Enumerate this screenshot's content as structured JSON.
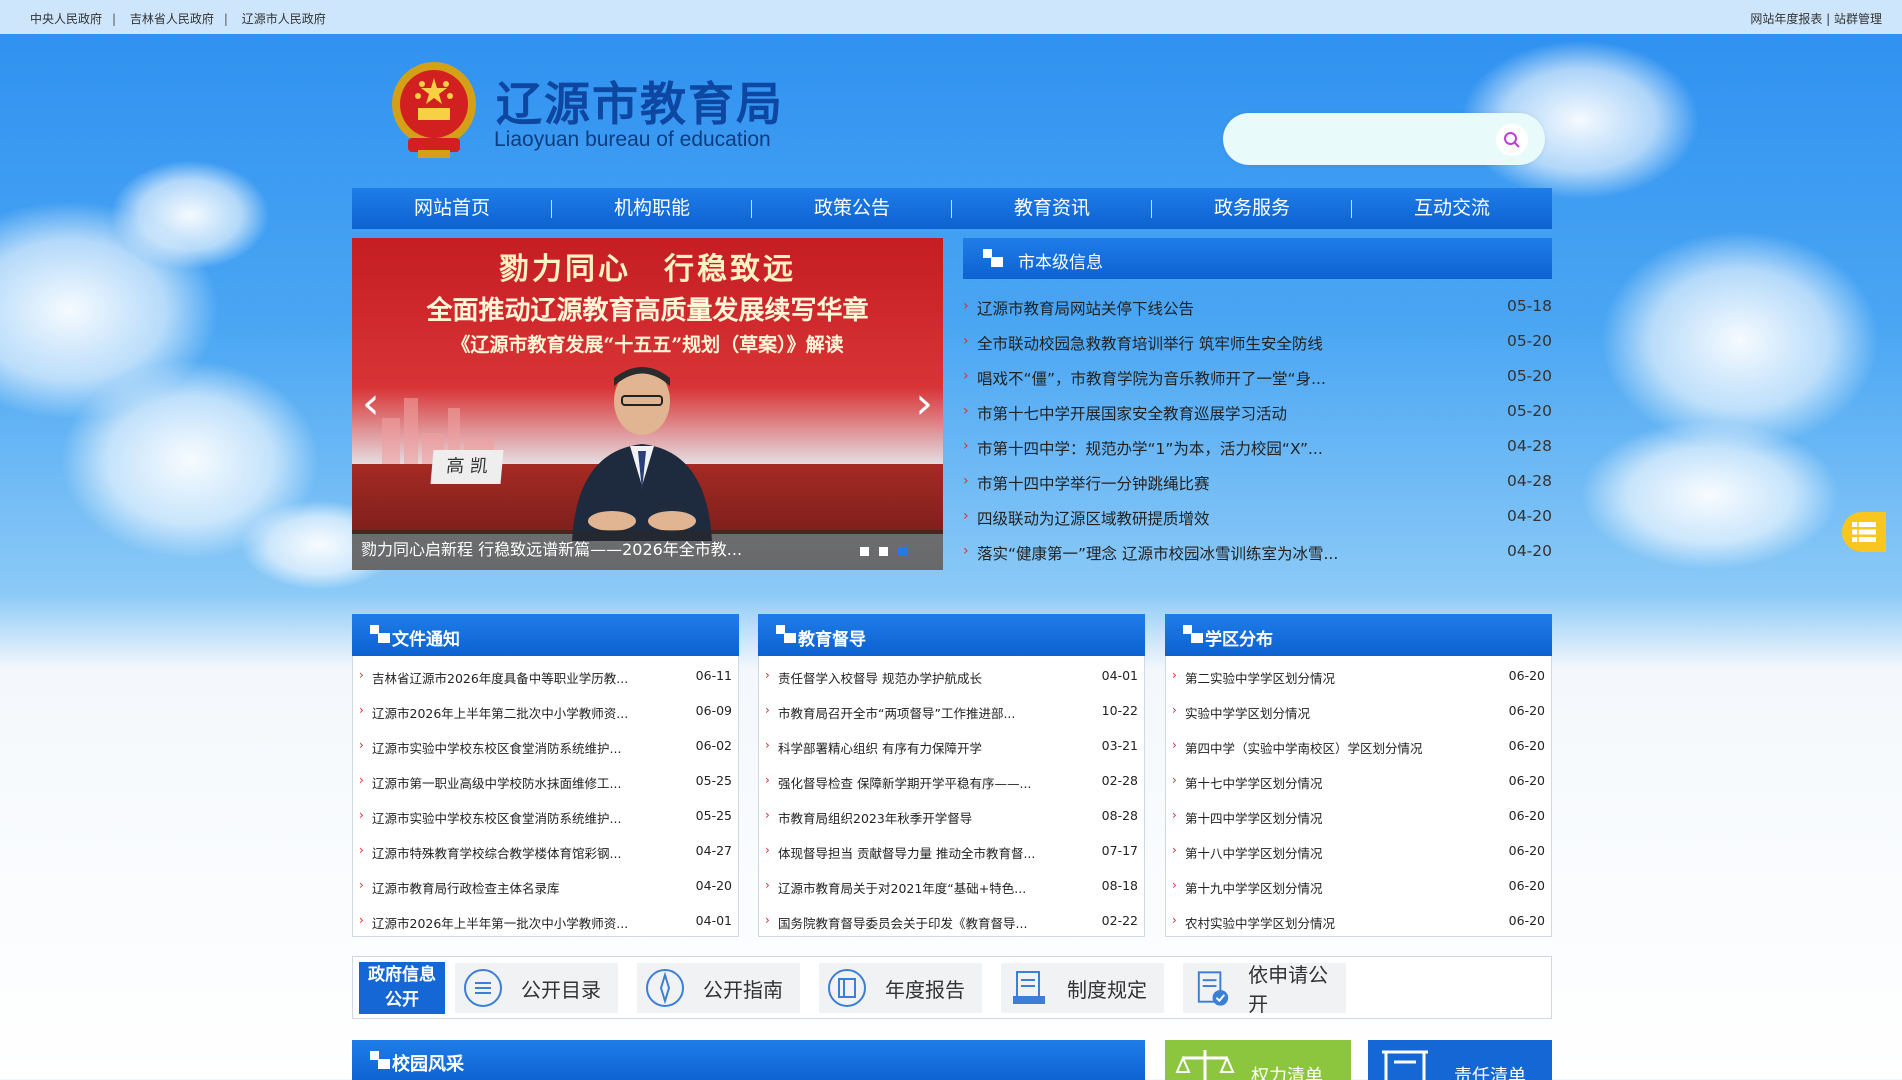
{
  "topbar": {
    "links": [
      "中央人民政府",
      "吉林省人民政府",
      "辽源市人民政府"
    ],
    "right": "网站年度报表 | 站群管理"
  },
  "header": {
    "title": "辽源市教育局",
    "subtitle": "Liaoyuan bureau of education",
    "search_placeholder": ""
  },
  "nav": [
    "网站首页",
    "机构职能",
    "政策公告",
    "教育资讯",
    "政务服务",
    "互动交流"
  ],
  "banner": {
    "line1": "勠力同心　行稳致远",
    "line2": "全面推动辽源教育高质量发展续写华章",
    "line3": "《辽源市教育发展“十五五”规划（草案）》解读",
    "nameplate": "高 凯",
    "caption": "勠力同心启新程 行稳致远谱新篇——2026年全市教..."
  },
  "news": {
    "title": "市本级信息",
    "items": [
      {
        "text": "辽源市教育局网站关停下线公告",
        "date": "05-18"
      },
      {
        "text": "全市联动校园急救教育培训举行 筑牢师生安全防线",
        "date": "05-20"
      },
      {
        "text": "唱戏不“僵”，市教育学院为音乐教师开了一堂“身...",
        "date": "05-20"
      },
      {
        "text": "市第十七中学开展国家安全教育巡展学习活动",
        "date": "05-20"
      },
      {
        "text": "市第十四中学：规范办学“1”为本，活力校园“X”...",
        "date": "04-28"
      },
      {
        "text": "市第十四中学举行一分钟跳绳比赛",
        "date": "04-28"
      },
      {
        "text": "四级联动为辽源区域教研提质增效",
        "date": "04-20"
      },
      {
        "text": "落实“健康第一”理念 辽源市校园冰雪训练室为冰雪...",
        "date": "04-20"
      }
    ]
  },
  "columns": [
    {
      "title": "文件通知",
      "items": [
        {
          "text": "吉林省辽源市2026年度具备中等职业学历教...",
          "date": "06-11"
        },
        {
          "text": "辽源市2026年上半年第二批次中小学教师资...",
          "date": "06-09"
        },
        {
          "text": "辽源市实验中学校东校区食堂消防系统维护...",
          "date": "06-02"
        },
        {
          "text": "辽源市第一职业高级中学校防水抹面维修工...",
          "date": "05-25"
        },
        {
          "text": "辽源市实验中学校东校区食堂消防系统维护...",
          "date": "05-25"
        },
        {
          "text": "辽源市特殊教育学校综合教学楼体育馆彩钢...",
          "date": "04-27"
        },
        {
          "text": "辽源市教育局行政检查主体名录库",
          "date": "04-20"
        },
        {
          "text": "辽源市2026年上半年第一批次中小学教师资...",
          "date": "04-01"
        }
      ]
    },
    {
      "title": "教育督导",
      "items": [
        {
          "text": "责任督学入校督导 规范办学护航成长",
          "date": "04-01"
        },
        {
          "text": "市教育局召开全市“两项督导”工作推进部...",
          "date": "10-22"
        },
        {
          "text": "科学部署精心组织 有序有力保障开学",
          "date": "03-21"
        },
        {
          "text": "强化督导检查 保障新学期开学平稳有序——...",
          "date": "02-28"
        },
        {
          "text": "市教育局组织2023年秋季开学督导",
          "date": "08-28"
        },
        {
          "text": "体现督导担当 贡献督导力量 推动全市教育督...",
          "date": "07-17"
        },
        {
          "text": "辽源市教育局关于对2021年度“基础+特色...",
          "date": "08-18"
        },
        {
          "text": "国务院教育督导委员会关于印发《教育督导...",
          "date": "02-22"
        }
      ]
    },
    {
      "title": "学区分布",
      "items": [
        {
          "text": "第二实验中学学区划分情况",
          "date": "06-20"
        },
        {
          "text": "实验中学学区划分情况",
          "date": "06-20"
        },
        {
          "text": "第四中学（实验中学南校区）学区划分情况",
          "date": "06-20"
        },
        {
          "text": "第十七中学学区划分情况",
          "date": "06-20"
        },
        {
          "text": "第十四中学学区划分情况",
          "date": "06-20"
        },
        {
          "text": "第十八中学学区划分情况",
          "date": "06-20"
        },
        {
          "text": "第十九中学学区划分情况",
          "date": "06-20"
        },
        {
          "text": "农村实验中学学区划分情况",
          "date": "06-20"
        }
      ]
    }
  ],
  "govinfo": {
    "label_line1": "政府信息",
    "label_line2": "公开",
    "buttons": [
      {
        "label": "公开目录",
        "icon": "list-icon"
      },
      {
        "label": "公开指南",
        "icon": "compass-icon"
      },
      {
        "label": "年度报告",
        "icon": "book-icon"
      },
      {
        "label": "制度规定",
        "icon": "document-icon"
      },
      {
        "label": "依申请公开",
        "icon": "checklist-icon"
      }
    ]
  },
  "bottom": {
    "campus_title": "校园风采",
    "green_label": "权力清单",
    "blue_label": "责任清单"
  },
  "colors": {
    "primary": "#1467d4",
    "accent_red": "#e02a2a",
    "green": "#8cc63f",
    "float_yellow": "#f8c61e"
  }
}
